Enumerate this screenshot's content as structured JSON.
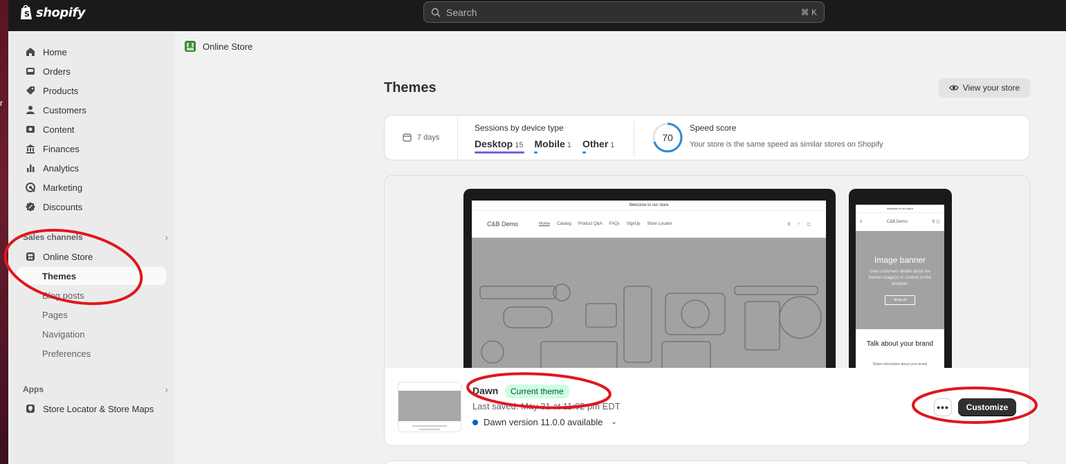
{
  "desktop_edge_text": "r",
  "topbar": {
    "brand": "shopify",
    "search_placeholder": "Search",
    "search_shortcut": "⌘ K"
  },
  "sidebar": {
    "main_items": [
      {
        "label": "Home",
        "icon": "home-icon"
      },
      {
        "label": "Orders",
        "icon": "inbox-icon"
      },
      {
        "label": "Products",
        "icon": "tag-icon"
      },
      {
        "label": "Customers",
        "icon": "person-icon"
      },
      {
        "label": "Content",
        "icon": "image-icon"
      },
      {
        "label": "Finances",
        "icon": "bank-icon"
      },
      {
        "label": "Analytics",
        "icon": "bar-chart-icon"
      },
      {
        "label": "Marketing",
        "icon": "target-icon"
      },
      {
        "label": "Discounts",
        "icon": "discount-icon"
      }
    ],
    "sales_channels_label": "Sales channels",
    "online_store_label": "Online Store",
    "sub_items": [
      "Themes",
      "Blog posts",
      "Pages",
      "Navigation",
      "Preferences"
    ],
    "apps_label": "Apps",
    "app_item_label": "Store Locator & Store Maps"
  },
  "breadcrumb": {
    "label": "Online Store"
  },
  "page": {
    "title": "Themes",
    "view_store_label": "View your store"
  },
  "stats": {
    "period": "7 days",
    "sessions_label": "Sessions by device type",
    "devices": [
      {
        "name": "Desktop",
        "count": "15",
        "color": "#7b5cde"
      },
      {
        "name": "Mobile",
        "count": "1",
        "color": "#2b8ad3"
      },
      {
        "name": "Other",
        "count": "1",
        "color": "#2b8ad3"
      }
    ],
    "speed_score": "70",
    "speed_title": "Speed score",
    "speed_desc": "Your store is the same speed as similar stores on Shopify"
  },
  "preview": {
    "announcement": "Welcome to our store",
    "store_name": "C&B Demo",
    "nav_links": [
      "Home",
      "Catalog",
      "Product Q&A",
      "FAQs",
      "SignUp",
      "Store Locator"
    ],
    "mobile_hero_title": "Image banner",
    "mobile_hero_sub": "Give customers details about the banner image(s) or content on the template.",
    "mobile_hero_button": "Shop all",
    "mobile_talk": "Talk about your brand",
    "mobile_share": "Share information about your brand"
  },
  "theme": {
    "name": "Dawn",
    "badge": "Current theme",
    "last_saved": "Last saved: May 31 at 11:02 pm EDT",
    "version": "Dawn version 11.0.0 available",
    "more_label": "•••",
    "customize_label": "Customize"
  },
  "colors": {
    "topbar": "#1a1a1a",
    "annotation_red": "#e0161c",
    "badge_bg": "#cdfee1",
    "primary_button": "#303030"
  }
}
